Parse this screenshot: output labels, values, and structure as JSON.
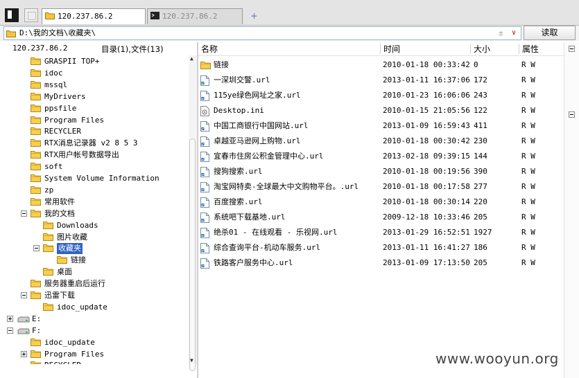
{
  "tabs": [
    {
      "label": "120.237.86.2",
      "active": true
    },
    {
      "label": "120.237.86.2",
      "active": false
    }
  ],
  "tab_add_label": "+",
  "address": {
    "path": "D:\\我的文档\\收藏夹\\",
    "stepper": "±",
    "dropdown": "∨",
    "read_button": "读取"
  },
  "left_panel": {
    "host": "120.237.86.2",
    "summary": "目录(1),文件(13)"
  },
  "tree": [
    {
      "label": "GRASPII TOP+",
      "depth": 2
    },
    {
      "label": "idoc",
      "depth": 2
    },
    {
      "label": "mssql",
      "depth": 2
    },
    {
      "label": "MyDrivers",
      "depth": 2
    },
    {
      "label": "ppsfile",
      "depth": 2
    },
    {
      "label": "Program Files",
      "depth": 2
    },
    {
      "label": "RECYCLER",
      "depth": 2
    },
    {
      "label": "RTX消息记录器 v2 8 5 3",
      "depth": 2
    },
    {
      "label": "RTX用户帐号数据导出",
      "depth": 2
    },
    {
      "label": "soft",
      "depth": 2
    },
    {
      "label": "System Volume Information",
      "depth": 2
    },
    {
      "label": "zp",
      "depth": 2
    },
    {
      "label": "常用软件",
      "depth": 2
    },
    {
      "label": "我的文档",
      "depth": 2,
      "expander": "minus"
    },
    {
      "label": "Downloads",
      "depth": 3
    },
    {
      "label": "图片收藏",
      "depth": 3
    },
    {
      "label": "收藏夹",
      "depth": 3,
      "expander": "minus",
      "selected": true
    },
    {
      "label": "链接",
      "depth": 4
    },
    {
      "label": "桌面",
      "depth": 3
    },
    {
      "label": "服务器重启后运行",
      "depth": 2
    },
    {
      "label": "迅雷下载",
      "depth": 2,
      "expander": "minus"
    },
    {
      "label": "idoc_update",
      "depth": 3
    },
    {
      "label": "E:",
      "depth": 0,
      "expander": "plus",
      "drive": true
    },
    {
      "label": "F:",
      "depth": 0,
      "expander": "minus",
      "drive": true
    },
    {
      "label": "idoc_update",
      "depth": 2
    },
    {
      "label": "Program Files",
      "depth": 2,
      "expander": "plus"
    },
    {
      "label": "RECYCLER",
      "depth": 2
    }
  ],
  "columns": {
    "name": "名称",
    "time": "时间",
    "size": "大小",
    "attr": "属性"
  },
  "files": [
    {
      "name": "链接",
      "time": "2010-01-18 00:33:42",
      "size": "0",
      "attr": "R W",
      "icon": "folder-icon"
    },
    {
      "name": "一深圳交警.url",
      "time": "2013-01-11 16:37:06",
      "size": "172",
      "attr": "R W",
      "icon": "url-file-icon"
    },
    {
      "name": "115ye绿色网址之家.url",
      "time": "2010-01-23 16:06:06",
      "size": "243",
      "attr": "R W",
      "icon": "url-file-icon"
    },
    {
      "name": "Desktop.ini",
      "time": "2010-01-15 21:05:56",
      "size": "122",
      "attr": "R W",
      "icon": "ini-file-icon"
    },
    {
      "name": "中国工商银行中国网站.url",
      "time": "2013-01-09 16:59:43",
      "size": "411",
      "attr": "R W",
      "icon": "url-file-icon"
    },
    {
      "name": "卓越亚马逊网上购物.url",
      "time": "2010-01-18 00:30:42",
      "size": "230",
      "attr": "R W",
      "icon": "url-file-icon"
    },
    {
      "name": "宜春市住房公积金管理中心.url",
      "time": "2013-02-18 09:39:15",
      "size": "144",
      "attr": "R W",
      "icon": "url-file-icon"
    },
    {
      "name": "搜狗搜索.url",
      "time": "2010-01-18 00:19:56",
      "size": "390",
      "attr": "R W",
      "icon": "url-file-icon"
    },
    {
      "name": "淘宝网特卖-全球最大中文购物平台。.url",
      "time": "2010-01-18 00:17:58",
      "size": "277",
      "attr": "R W",
      "icon": "url-file-icon"
    },
    {
      "name": "百度搜索.url",
      "time": "2010-01-18 00:30:14",
      "size": "220",
      "attr": "R W",
      "icon": "url-file-icon"
    },
    {
      "name": "系统吧下载基地.url",
      "time": "2009-12-18 10:33:46",
      "size": "205",
      "attr": "R W",
      "icon": "url-file-icon"
    },
    {
      "name": "绝杀01 - 在线观看 - 乐视网.url",
      "time": "2013-01-29 16:52:51",
      "size": "1927",
      "attr": "R W",
      "icon": "url-file-icon"
    },
    {
      "name": "综合查询平台-机动车服务.url",
      "time": "2013-01-11 16:41:27",
      "size": "186",
      "attr": "R W",
      "icon": "url-file-icon"
    },
    {
      "name": "铁路客户服务中心.url",
      "time": "2013-01-09 17:13:50",
      "size": "205",
      "attr": "R W",
      "icon": "url-file-icon"
    }
  ],
  "watermark": "www.wooyun.org"
}
